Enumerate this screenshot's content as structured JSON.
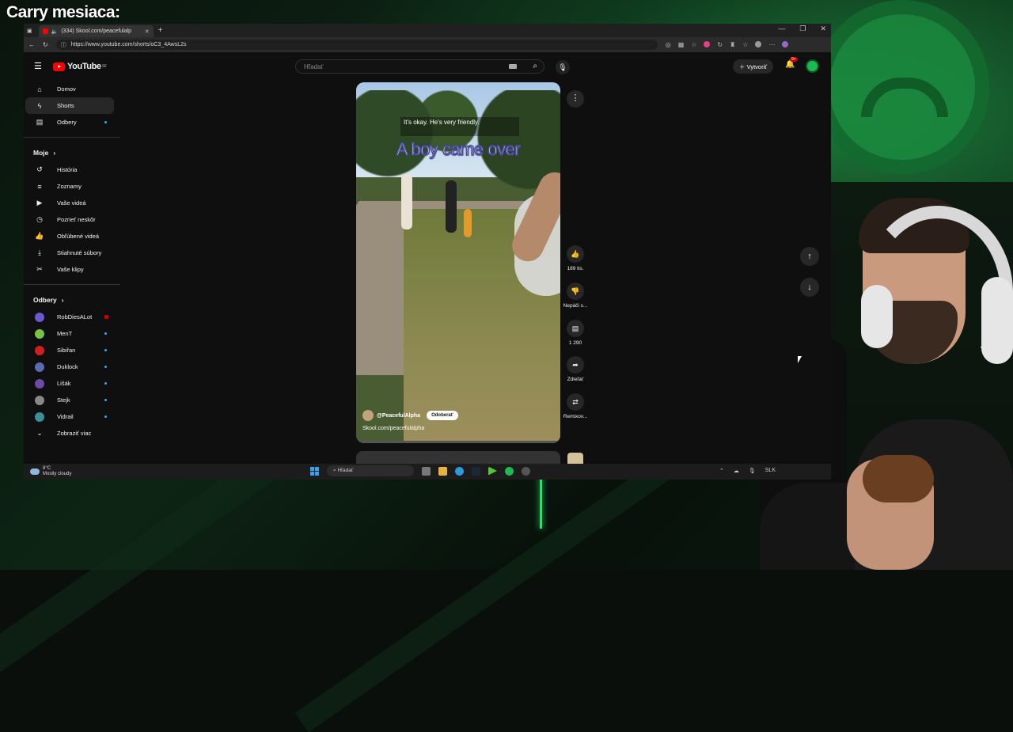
{
  "overlay_title": "Carry mesiaca:",
  "browser": {
    "tab_title": "(334) Skool.com/peacefulalp",
    "url": "https://www.youtube.com/shorts/oC3_4AwsL2s"
  },
  "youtube": {
    "logo_text": "YouTube",
    "region": "SK",
    "search_placeholder": "Hľadať",
    "create_label": "Vytvoriť",
    "notif_count": "9+",
    "nav": [
      {
        "label": "Domov",
        "icon": "home-icon"
      },
      {
        "label": "Shorts",
        "icon": "shorts-icon"
      },
      {
        "label": "Odbery",
        "icon": "subscriptions-icon"
      }
    ],
    "you_section": "Moje",
    "you_items": [
      {
        "label": "História"
      },
      {
        "label": "Zoznamy"
      },
      {
        "label": "Vaše videá"
      },
      {
        "label": "Pozrieť neskôr"
      },
      {
        "label": "Obľúbené videá"
      },
      {
        "label": "Stiahnuté súbory"
      },
      {
        "label": "Vaše klipy"
      }
    ],
    "subs_section": "Odbery",
    "subs": [
      {
        "name": "RobDiesALot",
        "color": "#6a5acd"
      },
      {
        "name": "MenT",
        "color": "#7bc142"
      },
      {
        "name": "Sibiřan",
        "color": "#d11f1f"
      },
      {
        "name": "Duklock",
        "color": "#5a6bb0"
      },
      {
        "name": "Lišák",
        "color": "#6d4aa8"
      },
      {
        "name": "Stejk",
        "color": "#888888"
      },
      {
        "name": "Vidrail",
        "color": "#3a8f9a"
      }
    ],
    "show_more": "Zobraziť viac",
    "short": {
      "caption_small": "It's okay. He's very friendly.",
      "caption_big": "A boy came over",
      "channel": "@PeacefulAlpha",
      "subscribe": "Odoberať",
      "link": "Skool.com/peacefulalpha",
      "likes": "189 tis.",
      "dislike": "Nepáči s...",
      "comments": "1 290",
      "share": "Zdieľať",
      "remix": "Remixov..."
    }
  },
  "taskbar": {
    "temp": "8°C",
    "weather": "Mostly cloudy",
    "search": "Hľadať",
    "lang": "SLK"
  }
}
